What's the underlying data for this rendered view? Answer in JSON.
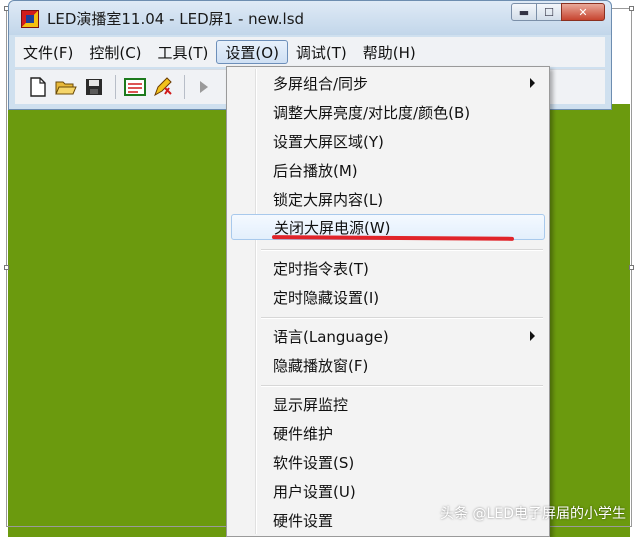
{
  "window": {
    "title": "LED演播室11.04 - LED屏1 - new.lsd",
    "min_glyph": "▬",
    "max_glyph": "☐",
    "close_glyph": "✕"
  },
  "menubar": {
    "items": [
      "文件(F)",
      "控制(C)",
      "工具(T)",
      "设置(O)",
      "调试(T)",
      "帮助(H)"
    ],
    "active": "设置(O)"
  },
  "toolbar": {
    "icons": [
      "new-file-icon",
      "open-folder-icon",
      "save-icon",
      "screen-edit-icon",
      "pen-edit-icon",
      "play-icon"
    ]
  },
  "settings_menu": {
    "items": [
      {
        "label": "多屏组合/同步",
        "submenu": true
      },
      {
        "label": "调整大屏亮度/对比度/颜色(B)",
        "submenu": false
      },
      {
        "label": "设置大屏区域(Y)",
        "submenu": false
      },
      {
        "label": "后台播放(M)",
        "submenu": false
      },
      {
        "label": "锁定大屏内容(L)",
        "submenu": false
      },
      {
        "label": "关闭大屏电源(W)",
        "submenu": false,
        "highlighted": true
      },
      {
        "label": "定时指令表(T)",
        "submenu": false
      },
      {
        "label": "定时隐藏设置(I)",
        "submenu": false
      },
      {
        "label": "语言(Language)",
        "submenu": true
      },
      {
        "label": "隐藏播放窗(F)",
        "submenu": false
      },
      {
        "label": "显示屏监控",
        "submenu": false
      },
      {
        "label": "硬件维护",
        "submenu": false
      },
      {
        "label": "软件设置(S)",
        "submenu": false
      },
      {
        "label": "用户设置(U)",
        "submenu": false
      },
      {
        "label": "硬件设置",
        "submenu": false
      }
    ]
  },
  "watermark": "头条 @LED电子屏届的小学生",
  "colors": {
    "canvas": "#6b9a0e",
    "annotation_underline": "#e0242a"
  }
}
